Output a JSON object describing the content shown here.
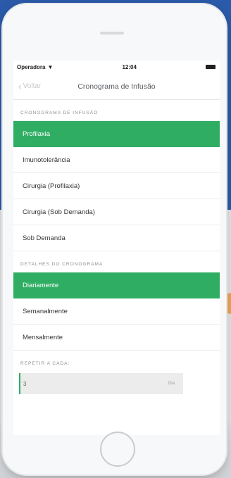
{
  "status_bar": {
    "carrier": "Operadora",
    "time": "12:04"
  },
  "nav": {
    "back_label": "Voltar",
    "title": "Cronograma de Infusão"
  },
  "schedule_section": {
    "header": "CRONOGRAMA DE INFUSÃO",
    "options": [
      {
        "label": "Profilaxia",
        "selected": true
      },
      {
        "label": "Imunotolerância",
        "selected": false
      },
      {
        "label": "Cirurgia (Profilaxia)",
        "selected": false
      },
      {
        "label": "Cirurgia (Sob Demanda)",
        "selected": false
      },
      {
        "label": "Sob Demanda",
        "selected": false
      }
    ]
  },
  "details_section": {
    "header": "DETALHES DO CRONOGRAMA",
    "options": [
      {
        "label": "Diariamente",
        "selected": true
      },
      {
        "label": "Semanalmente",
        "selected": false
      },
      {
        "label": "Mensalmente",
        "selected": false
      }
    ]
  },
  "repeat_section": {
    "header": "REPETIR A CADA:",
    "value": "3",
    "unit": "Dia"
  },
  "colors": {
    "accent": "#2fae63",
    "background_blue": "#2a5aa9"
  }
}
